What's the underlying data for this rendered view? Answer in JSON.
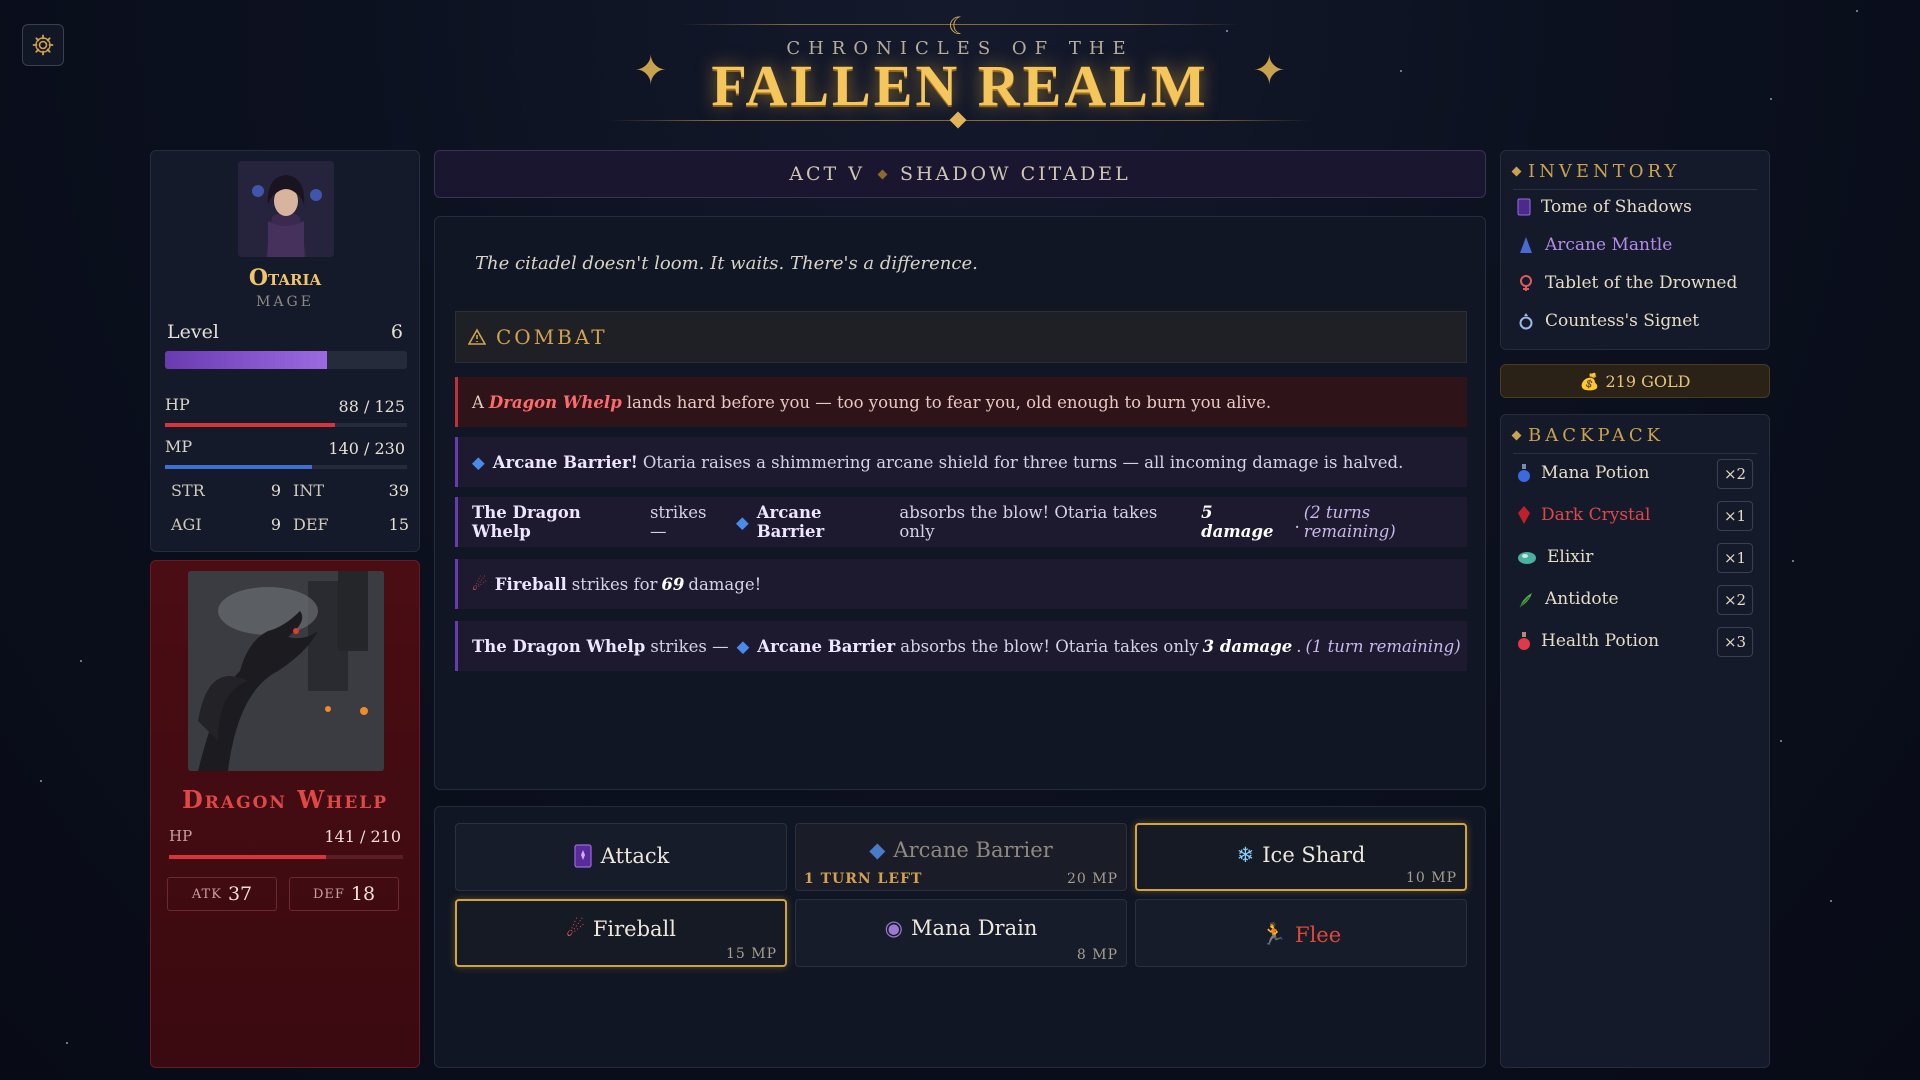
{
  "title": {
    "subtitle": "CHRONICLES OF THE",
    "main": "FALLEN REALM"
  },
  "settings": {
    "icon": "gear-icon"
  },
  "hero": {
    "name": "Otaria",
    "class": "MAGE",
    "level_label": "Level",
    "level": "6",
    "xp_fraction": 0.67,
    "hp_label": "HP",
    "hp": "88 / 125",
    "hp_fraction": 0.704,
    "mp_label": "MP",
    "mp": "140 / 230",
    "mp_fraction": 0.609,
    "attributes": [
      {
        "label": "STR",
        "value": "9"
      },
      {
        "label": "INT",
        "value": "39"
      },
      {
        "label": "AGI",
        "value": "9"
      },
      {
        "label": "DEF",
        "value": "15"
      }
    ]
  },
  "enemy": {
    "name": "Dragon Whelp",
    "hp_label": "HP",
    "hp": "141 / 210",
    "hp_fraction": 0.671,
    "atk_label": "ATK",
    "atk": "37",
    "def_label": "DEF",
    "def": "18"
  },
  "location": {
    "act": "ACT V",
    "place": "SHADOW CITADEL"
  },
  "log": {
    "narration": "The citadel doesn't loom. It waits. There's a difference.",
    "combat_label": "COMBAT",
    "entries": [
      {
        "a": "A",
        "whelp": "Dragon Whelp",
        "rest": "lands hard before you — too young to fear you, old enough to burn you alive."
      },
      {
        "bold": "Arcane Barrier!",
        "rest": "Otaria raises a shimmering arcane shield for three turns — all incoming damage is halved."
      },
      {
        "lead": "The Dragon Whelp",
        "mid": "strikes —",
        "skill": "Arcane Barrier",
        "rest": "absorbs the blow! Otaria takes only",
        "dmg": "5 damage",
        "dot": ".",
        "turns": "(2 turns remaining)"
      },
      {
        "skill": "Fireball",
        "pre": "strikes for",
        "dmg": "69",
        "post": "damage!"
      },
      {
        "lead": "The Dragon Whelp",
        "mid": "strikes —",
        "skill": "Arcane Barrier",
        "rest": "absorbs the blow! Otaria takes only",
        "dmg": "3 damage",
        "dot": ".",
        "turns": "(1 turn remaining)"
      }
    ]
  },
  "actions": {
    "attack": {
      "label": "Attack",
      "icon": "tome-icon"
    },
    "barrier": {
      "label": "Arcane Barrier",
      "turns": "1 TURN LEFT",
      "cost": "20 MP",
      "icon": "diamond-icon"
    },
    "ice": {
      "label": "Ice Shard",
      "cost": "10 MP",
      "icon": "snowflake-icon"
    },
    "fireball": {
      "label": "Fireball",
      "cost": "15 MP",
      "icon": "fire-icon"
    },
    "drain": {
      "label": "Mana Drain",
      "cost": "8 MP",
      "icon": "orb-icon"
    },
    "flee": {
      "label": "Flee",
      "icon": "running-icon"
    }
  },
  "inventory": {
    "title": "INVENTORY",
    "items": [
      {
        "label": "Tome of Shadows",
        "icon": "tome-icon"
      },
      {
        "label": "Arcane Mantle",
        "icon": "mantle-icon"
      },
      {
        "label": "Tablet of the Drowned",
        "icon": "tablet-icon"
      },
      {
        "label": "Countess's Signet",
        "icon": "ring-icon"
      }
    ]
  },
  "gold": {
    "label": "219 GOLD",
    "icon": "coin-bag-icon"
  },
  "backpack": {
    "title": "BACKPACK",
    "items": [
      {
        "label": "Mana Potion",
        "qty": "×2",
        "icon": "mana-potion-icon"
      },
      {
        "label": "Dark Crystal",
        "qty": "×1",
        "icon": "crystal-icon"
      },
      {
        "label": "Elixir",
        "qty": "×1",
        "icon": "elixir-icon"
      },
      {
        "label": "Antidote",
        "qty": "×2",
        "icon": "herb-icon"
      },
      {
        "label": "Health Potion",
        "qty": "×3",
        "icon": "health-potion-icon"
      }
    ]
  },
  "colors": {
    "gold": "#f4c65c",
    "hp": "#d9343c",
    "mp": "#3f6fd0",
    "xp": "#8a5ad0",
    "enemy_name": "#e04848"
  }
}
